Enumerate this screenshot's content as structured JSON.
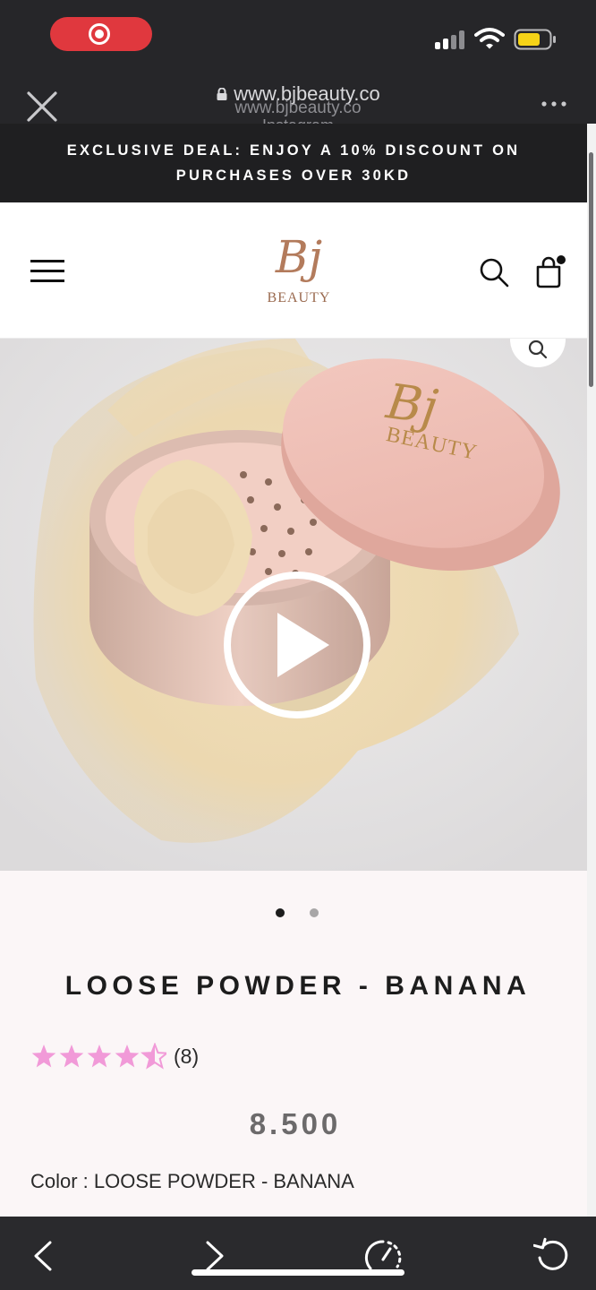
{
  "browser": {
    "url": "www.bjbeauty.co",
    "url_ghost": "www.bjbeauty.co",
    "source": "Instagram"
  },
  "promo": {
    "text": "EXCLUSIVE DEAL: ENJOY A 10% DISCOUNT ON PURCHASES OVER 30KD"
  },
  "header": {
    "logo_script": "Bj",
    "logo_text": "BEAUTY"
  },
  "product": {
    "title": "LOOSE POWDER - BANANA",
    "rating_value": 4.5,
    "rating_max": 5,
    "review_count": "(8)",
    "price": "8.500",
    "color_line": "Color : LOOSE POWDER - BANANA",
    "image_count": 2,
    "active_image": 1
  },
  "colors": {
    "star": "#f19ad8",
    "status_bg": "#262629",
    "promo_bg": "#1f1f21",
    "details_bg": "#fbf6f7",
    "logo": "#b37b5c",
    "recording": "#e0383e",
    "battery": "#f5d317"
  },
  "icons": [
    "close-icon",
    "lock-icon",
    "more-icon",
    "hamburger-icon",
    "search-icon",
    "bag-icon",
    "zoom-icon",
    "play-icon",
    "back-icon",
    "forward-icon",
    "speed-icon",
    "reload-icon"
  ]
}
